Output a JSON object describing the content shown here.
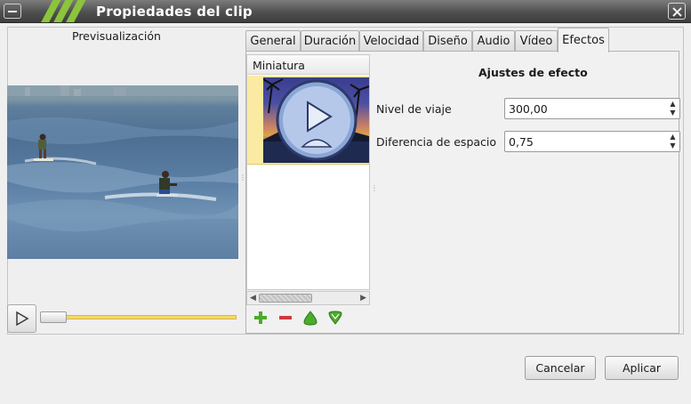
{
  "window": {
    "title": "Propiedades del clip",
    "accent_color": "#8cc43c"
  },
  "preview": {
    "label": "Previsualización",
    "play_icon": "play-icon",
    "slider_color": "#f3d86a"
  },
  "tabs": [
    {
      "label": "General"
    },
    {
      "label": "Duración"
    },
    {
      "label": "Velocidad"
    },
    {
      "label": "Diseño"
    },
    {
      "label": "Audio"
    },
    {
      "label": "Vídeo"
    },
    {
      "label": "Efectos"
    }
  ],
  "active_tab": "Efectos",
  "effects": {
    "list_header": "Miniatura",
    "toolbar_icons": [
      "add-icon",
      "remove-icon",
      "move-up-icon",
      "move-down-icon"
    ]
  },
  "settings": {
    "title": "Ajustes de efecto",
    "fields": [
      {
        "label": "Nivel de viaje",
        "value": "300,00"
      },
      {
        "label": "Diferencia de espacio",
        "value": "0,75"
      }
    ]
  },
  "buttons": {
    "cancel": "Cancelar",
    "apply": "Aplicar"
  }
}
